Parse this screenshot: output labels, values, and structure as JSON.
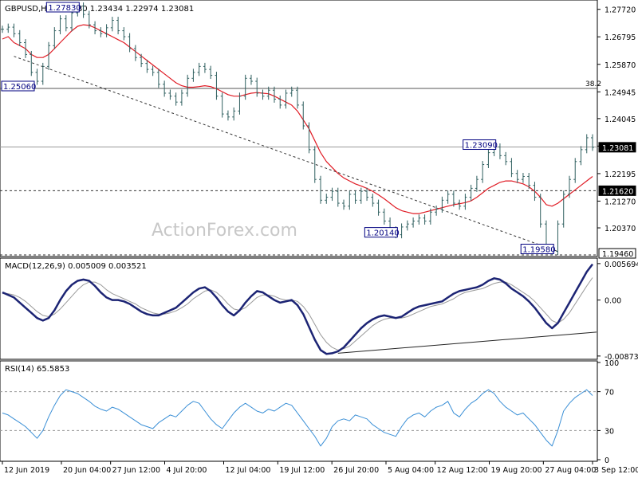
{
  "chart_data": [
    {
      "type": "line",
      "panel": "price",
      "header": {
        "symbol": "GBPUSD",
        "timeframe": "H4",
        "ohlc": [
          "1.23280",
          "1.23434",
          "1.22974",
          "1.23081"
        ]
      },
      "ylim": [
        1.1946,
        1.2798
      ],
      "y_ticks": [
        "1.27720",
        "1.26795",
        "1.25870",
        "1.24945",
        "1.24045",
        "1.23120",
        "1.22195",
        "1.21270",
        "1.20370"
      ],
      "y_tick_values": [
        1.2772,
        1.26795,
        1.2587,
        1.24945,
        1.24045,
        1.2312,
        1.22195,
        1.2127,
        1.2037
      ],
      "series": [
        {
          "role": "price",
          "color": "#2f5f5f",
          "values": [
            1.2705,
            1.2712,
            1.269,
            1.266,
            1.262,
            1.256,
            1.253,
            1.258,
            1.265,
            1.27,
            1.274,
            1.271,
            1.276,
            1.2783,
            1.2755,
            1.272,
            1.27,
            1.269,
            1.271,
            1.2735,
            1.27,
            1.268,
            1.264,
            1.261,
            1.259,
            1.257,
            1.256,
            1.252,
            1.249,
            1.248,
            1.246,
            1.249,
            1.254,
            1.256,
            1.258,
            1.257,
            1.255,
            1.248,
            1.242,
            1.241,
            1.243,
            1.248,
            1.254,
            1.253,
            1.249,
            1.248,
            1.25,
            1.247,
            1.245,
            1.249,
            1.25,
            1.245,
            1.238,
            1.23,
            1.22,
            1.213,
            1.214,
            1.216,
            1.212,
            1.211,
            1.215,
            1.213,
            1.216,
            1.214,
            1.212,
            1.209,
            1.206,
            1.203,
            1.2014,
            1.204,
            1.205,
            1.206,
            1.207,
            1.206,
            1.209,
            1.21,
            1.213,
            1.215,
            1.212,
            1.211,
            1.214,
            1.217,
            1.22,
            1.225,
            1.229,
            1.2309,
            1.228,
            1.226,
            1.222,
            1.22,
            1.221,
            1.218,
            1.214,
            1.205,
            1.197,
            1.1958,
            1.205,
            1.215,
            1.22,
            1.226,
            1.23,
            1.234,
            1.2308
          ]
        },
        {
          "role": "moving-average",
          "color": "#e01b24",
          "values": [
            1.2672,
            1.268,
            1.266,
            1.265,
            1.264,
            1.262,
            1.261,
            1.261,
            1.262,
            1.264,
            1.266,
            1.268,
            1.27,
            1.2715,
            1.272,
            1.2718,
            1.271,
            1.27,
            1.269,
            1.268,
            1.267,
            1.266,
            1.2645,
            1.263,
            1.2615,
            1.26,
            1.2585,
            1.257,
            1.2555,
            1.254,
            1.2525,
            1.2515,
            1.251,
            1.251,
            1.2512,
            1.2515,
            1.2512,
            1.2505,
            1.2495,
            1.2485,
            1.248,
            1.248,
            1.2485,
            1.249,
            1.2492,
            1.249,
            1.2488,
            1.248,
            1.247,
            1.246,
            1.245,
            1.243,
            1.24,
            1.237,
            1.233,
            1.229,
            1.226,
            1.224,
            1.222,
            1.2205,
            1.2195,
            1.2185,
            1.2178,
            1.217,
            1.216,
            1.2148,
            1.2135,
            1.212,
            1.2105,
            1.2095,
            1.209,
            1.2085,
            1.2085,
            1.209,
            1.2095,
            1.21,
            1.2105,
            1.211,
            1.2115,
            1.2118,
            1.2122,
            1.2128,
            1.214,
            1.2155,
            1.217,
            1.218,
            1.219,
            1.2195,
            1.2195,
            1.219,
            1.2185,
            1.2175,
            1.216,
            1.214,
            1.2115,
            1.211,
            1.212,
            1.2135,
            1.215,
            1.2165,
            1.218,
            1.2195,
            1.221
          ]
        }
      ],
      "hlines": [
        {
          "y": 1.2506,
          "label": "38.2",
          "style": "solid",
          "color": "#555555"
        },
        {
          "y": 1.2309,
          "style": "solid",
          "color": "#999999"
        },
        {
          "y": 1.2162,
          "style": "dashed",
          "color": "#333333"
        },
        {
          "y": 1.1946,
          "style": "dashed",
          "color": "#333333"
        }
      ],
      "trendline": {
        "from": [
          2,
          1.2614
        ],
        "to": [
          96,
          1.1958
        ],
        "style": "dashed",
        "color": "#333333"
      },
      "annotations": [
        {
          "text": "1.27830",
          "x": 13,
          "y": 1.2783,
          "side": "left"
        },
        {
          "text": "1.25060",
          "x": 0,
          "y": 1.2506,
          "side": "left"
        },
        {
          "text": "1.23090",
          "x": 85,
          "y": 1.2309,
          "side": "left"
        },
        {
          "text": "1.20140",
          "x": 68,
          "y": 1.2014,
          "side": "left"
        },
        {
          "text": "1.19580",
          "x": 95,
          "y": 1.1958,
          "side": "left"
        }
      ],
      "price_tags": [
        {
          "text": "1.23081",
          "y": 1.23081,
          "inverted": true
        },
        {
          "text": "1.21620",
          "y": 1.2162,
          "inverted": true
        },
        {
          "text": "1.19460",
          "y": 1.1946,
          "inverted": false
        }
      ],
      "watermark": "ActionForex.com"
    },
    {
      "type": "line",
      "panel": "macd",
      "header": {
        "name": "MACD(12,26,9)",
        "values": [
          "0.005009",
          "0.003521"
        ]
      },
      "ylim": [
        -0.009,
        0.0063
      ],
      "y_ticks": [
        "0.005694",
        "0.00",
        "-0.008737"
      ],
      "y_tick_values": [
        0.005694,
        0.0,
        -0.008737
      ],
      "series": [
        {
          "role": "macd",
          "color": "#1c2474",
          "values": [
            0.0012,
            0.0008,
            0.0004,
            -0.0004,
            -0.0012,
            -0.002,
            -0.0028,
            -0.0032,
            -0.0028,
            -0.0016,
            0.0,
            0.0014,
            0.0024,
            0.003,
            0.0032,
            0.003,
            0.0022,
            0.0012,
            0.0004,
            0.0,
            0.0,
            -0.0002,
            -0.0006,
            -0.0012,
            -0.0018,
            -0.0022,
            -0.0024,
            -0.0024,
            -0.002,
            -0.0016,
            -0.0012,
            -0.0004,
            0.0004,
            0.0012,
            0.0018,
            0.002,
            0.0014,
            0.0004,
            -0.0008,
            -0.0018,
            -0.0024,
            -0.0016,
            -0.0004,
            0.0006,
            0.0014,
            0.0012,
            0.0006,
            0.0,
            -0.0004,
            -0.0002,
            0.0,
            -0.0008,
            -0.0022,
            -0.0042,
            -0.0062,
            -0.0078,
            -0.0084,
            -0.0083,
            -0.008,
            -0.0074,
            -0.0064,
            -0.0054,
            -0.0044,
            -0.0036,
            -0.003,
            -0.0026,
            -0.0024,
            -0.0026,
            -0.0028,
            -0.0026,
            -0.002,
            -0.0014,
            -0.001,
            -0.0008,
            -0.0006,
            -0.0004,
            -0.0002,
            0.0004,
            0.001,
            0.0014,
            0.0016,
            0.0018,
            0.002,
            0.0024,
            0.003,
            0.0034,
            0.0032,
            0.0026,
            0.0018,
            0.0012,
            0.0006,
            -0.0002,
            -0.0012,
            -0.0024,
            -0.0036,
            -0.0044,
            -0.0036,
            -0.002,
            -0.0004,
            0.0012,
            0.0028,
            0.0044,
            0.0056
          ]
        },
        {
          "role": "signal",
          "color": "#999999",
          "values": [
            0.001,
            0.001,
            0.0008,
            0.0004,
            -0.0002,
            -0.001,
            -0.0018,
            -0.0024,
            -0.0026,
            -0.0022,
            -0.0014,
            -0.0004,
            0.0006,
            0.0016,
            0.0024,
            0.0028,
            0.0028,
            0.0024,
            0.0016,
            0.001,
            0.0006,
            0.0002,
            -0.0002,
            -0.0006,
            -0.0012,
            -0.0016,
            -0.002,
            -0.0022,
            -0.0022,
            -0.002,
            -0.0017,
            -0.0012,
            -0.0006,
            0.0002,
            0.0008,
            0.0014,
            0.0016,
            0.0012,
            0.0004,
            -0.0006,
            -0.0014,
            -0.0016,
            -0.0012,
            -0.0004,
            0.0004,
            0.0008,
            0.0008,
            0.0006,
            0.0002,
            0.0,
            0.0,
            -0.0002,
            -0.001,
            -0.0022,
            -0.0038,
            -0.0054,
            -0.0066,
            -0.0074,
            -0.0078,
            -0.0076,
            -0.0072,
            -0.0064,
            -0.0056,
            -0.0048,
            -0.004,
            -0.0034,
            -0.003,
            -0.0028,
            -0.0028,
            -0.0028,
            -0.0026,
            -0.0022,
            -0.0018,
            -0.0014,
            -0.001,
            -0.0008,
            -0.0006,
            -0.0002,
            0.0002,
            0.0008,
            0.0012,
            0.0014,
            0.0016,
            0.0018,
            0.0022,
            0.0026,
            0.0028,
            0.0028,
            0.0024,
            0.0018,
            0.0012,
            0.0006,
            -0.0002,
            -0.0012,
            -0.0022,
            -0.0032,
            -0.0036,
            -0.003,
            -0.002,
            -0.0006,
            0.0008,
            0.0022,
            0.0035
          ]
        }
      ],
      "trendline": {
        "from": [
          58,
          -0.0083
        ],
        "to": [
          104,
          -0.005
        ],
        "style": "solid",
        "color": "#222222"
      }
    },
    {
      "type": "line",
      "panel": "rsi",
      "header": {
        "name": "RSI(14)",
        "value": "65.5853"
      },
      "ylim": [
        0,
        100
      ],
      "y_ticks": [
        "100",
        "70",
        "30",
        "0"
      ],
      "y_tick_values": [
        100,
        70,
        30,
        0
      ],
      "levels": [
        70,
        30
      ],
      "series": [
        {
          "role": "rsi",
          "color": "#3a8fd6",
          "values": [
            48,
            46,
            42,
            38,
            34,
            28,
            22,
            30,
            44,
            56,
            66,
            72,
            70,
            68,
            64,
            60,
            55,
            52,
            50,
            54,
            52,
            48,
            44,
            40,
            36,
            34,
            32,
            38,
            42,
            46,
            44,
            50,
            56,
            60,
            58,
            50,
            42,
            36,
            32,
            40,
            48,
            54,
            58,
            54,
            50,
            48,
            52,
            50,
            54,
            58,
            56,
            48,
            40,
            32,
            24,
            14,
            22,
            34,
            40,
            42,
            40,
            46,
            44,
            42,
            36,
            32,
            28,
            26,
            24,
            34,
            42,
            46,
            48,
            44,
            50,
            54,
            56,
            60,
            48,
            44,
            52,
            58,
            62,
            68,
            72,
            68,
            60,
            54,
            50,
            46,
            48,
            42,
            36,
            28,
            20,
            14,
            30,
            50,
            58,
            64,
            68,
            72,
            66
          ]
        }
      ]
    }
  ],
  "x_axis": {
    "ticks": [
      "12 Jun 2019",
      "20 Jun 04:00",
      "27 Jun 12:00",
      "4 Jul 20:00",
      "12 Jul 04:00",
      "19 Jul 12:00",
      "26 Jul 20:00",
      "5 Aug 04:00",
      "12 Aug 12:00",
      "19 Aug 20:00",
      "27 Aug 04:00",
      "3 Sep 12:00"
    ],
    "tick_index": [
      0,
      12,
      22,
      33,
      45,
      56,
      67,
      78,
      88,
      99,
      110,
      120
    ],
    "n_points": 103
  },
  "colors": {
    "background": "#ffffff",
    "axis": "#000000",
    "grid_label_box": "#000080"
  }
}
